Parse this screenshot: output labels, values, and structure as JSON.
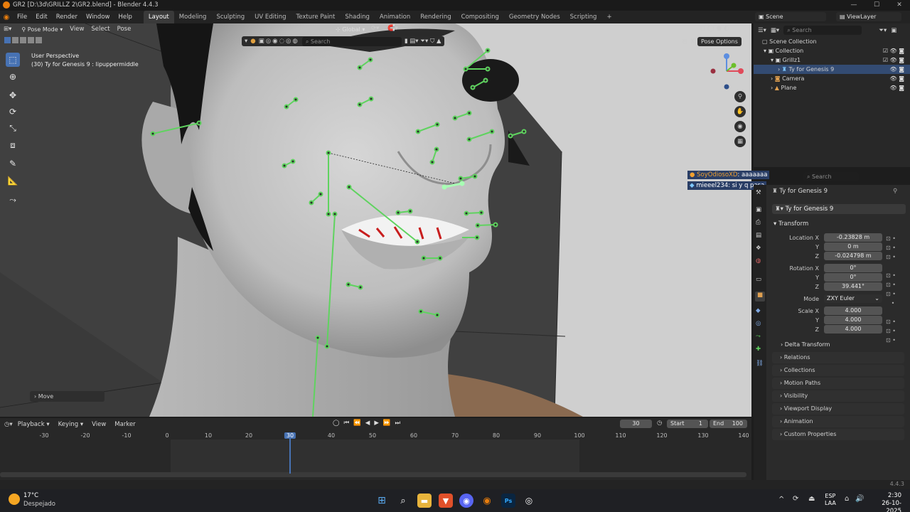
{
  "window": {
    "title": "GR2 [D:\\3d\\GRILLZ 2\\GR2.blend] - Blender 4.4.3",
    "minimize": "—",
    "maximize": "☐",
    "close": "✕"
  },
  "menu": {
    "items": [
      "File",
      "Edit",
      "Render",
      "Window",
      "Help"
    ]
  },
  "workspaces": {
    "tabs": [
      "Layout",
      "Modeling",
      "Sculpting",
      "UV Editing",
      "Texture Paint",
      "Shading",
      "Animation",
      "Rendering",
      "Compositing",
      "Geometry Nodes",
      "Scripting"
    ],
    "active": "Layout",
    "add": "+"
  },
  "scene": {
    "scene_name": "Scene",
    "view_layer": "ViewLayer"
  },
  "viewport": {
    "mode": "Pose Mode",
    "menus": [
      "View",
      "Select",
      "Pose"
    ],
    "orientation": "Global",
    "search_placeholder": "Search",
    "pose_options": "Pose Options",
    "info_line1": "User Perspective",
    "info_line2": "(30) Ty for Genesis 9 : lipuppermiddle",
    "last_op": "Move"
  },
  "outliner": {
    "search_placeholder": "Search",
    "rows": [
      {
        "label": "Scene Collection"
      },
      {
        "label": "Collection"
      },
      {
        "label": "Grillz1"
      },
      {
        "label": "Ty for Genesis 9"
      },
      {
        "label": "Camera"
      },
      {
        "label": "Plane"
      }
    ]
  },
  "chat": [
    {
      "user": "SoyOdiosoXD",
      "msg": ": aaaaaaa"
    },
    {
      "user": "mieeel234",
      "msg": ": si y q pasa"
    }
  ],
  "properties": {
    "search_placeholder": "Search",
    "breadcrumb": "Ty for Genesis 9",
    "object_name": "Ty for Genesis 9",
    "transform_title": "Transform",
    "location": {
      "label": "Location X",
      "x": "-0.23828 m",
      "y": "0 m",
      "z": "-0.024798 m"
    },
    "rotation": {
      "label": "Rotation X",
      "x": "0°",
      "y": "0°",
      "z": "39.441°"
    },
    "mode_label": "Mode",
    "mode_value": "ZXY Euler",
    "scale": {
      "label": "Scale X",
      "x": "4.000",
      "y": "4.000",
      "z": "4.000"
    },
    "axis_y": "Y",
    "axis_z": "Z",
    "delta": "Delta Transform",
    "sections": [
      "Relations",
      "Collections",
      "Motion Paths",
      "Visibility",
      "Viewport Display",
      "Animation",
      "Custom Properties"
    ]
  },
  "timeline": {
    "menus": [
      "Playback",
      "Keying",
      "View",
      "Marker"
    ],
    "current_frame": "30",
    "start_label": "Start",
    "start": "1",
    "end_label": "End",
    "end": "100",
    "ticks": [
      "-30",
      "-20",
      "-10",
      "0",
      "10",
      "20",
      "30",
      "40",
      "50",
      "60",
      "70",
      "80",
      "90",
      "100",
      "110",
      "120",
      "130",
      "140"
    ],
    "version": "4.4.3"
  },
  "taskbar": {
    "weather_temp": "17°C",
    "weather_desc": "Despejado",
    "lang1": "ESP",
    "lang2": "LAA",
    "time": "2:30",
    "date": "26-10-2025",
    "chevron": "^"
  },
  "colors": {
    "accent": "#4772b3",
    "bone": "#5fd35f",
    "bone_selected": "#a8ffb4",
    "chat_bg": "#2a3e66",
    "chat_user": "#f0a030"
  }
}
